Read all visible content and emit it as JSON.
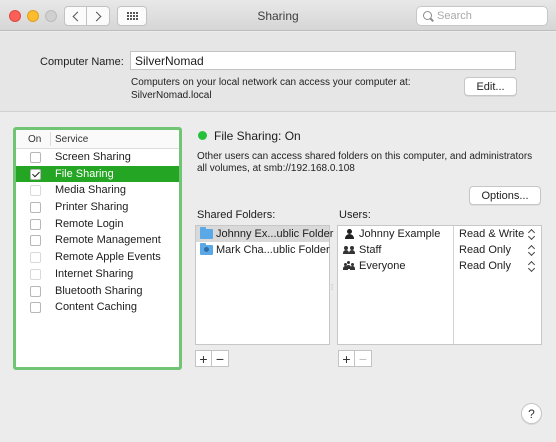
{
  "window": {
    "title": "Sharing",
    "search_placeholder": "Search"
  },
  "computer_name": {
    "label": "Computer Name:",
    "value": "SilverNomad",
    "description_line1": "Computers on your local network can access your computer at:",
    "description_line2": "SilverNomad.local",
    "edit_button": "Edit..."
  },
  "services": {
    "header_on": "On",
    "header_service": "Service",
    "items": [
      {
        "label": "Screen Sharing",
        "checked": false,
        "selected": false
      },
      {
        "label": "File Sharing",
        "checked": true,
        "selected": true
      },
      {
        "label": "Media Sharing",
        "checked": false,
        "selected": false
      },
      {
        "label": "Printer Sharing",
        "checked": false,
        "selected": false
      },
      {
        "label": "Remote Login",
        "checked": false,
        "selected": false
      },
      {
        "label": "Remote Management",
        "checked": false,
        "selected": false
      },
      {
        "label": "Remote Apple Events",
        "checked": false,
        "selected": false
      },
      {
        "label": "Internet Sharing",
        "checked": false,
        "selected": false
      },
      {
        "label": "Bluetooth Sharing",
        "checked": false,
        "selected": false
      },
      {
        "label": "Content Caching",
        "checked": false,
        "selected": false
      }
    ]
  },
  "status": {
    "text": "File Sharing: On",
    "color": "#26c03a",
    "description": "Other users can access shared folders on this computer, and administrators all volumes, at smb://192.168.0.108",
    "options_button": "Options..."
  },
  "shared_folders": {
    "label": "Shared Folders:",
    "items": [
      {
        "label": "Johnny Ex...ublic Folder",
        "icon": "folder-icon"
      },
      {
        "label": "Mark Cha...ublic Folder",
        "icon": "shared-folder-icon"
      }
    ],
    "add": "+",
    "remove": "−"
  },
  "users": {
    "label": "Users:",
    "items": [
      {
        "name": "Johnny Example",
        "permission": "Read & Write",
        "icon": "user-icon"
      },
      {
        "name": "Staff",
        "permission": "Read Only",
        "icon": "group-icon"
      },
      {
        "name": "Everyone",
        "permission": "Read Only",
        "icon": "everyone-icon"
      }
    ],
    "add": "+",
    "remove": "−"
  },
  "help": "?",
  "colors": {
    "accent_selection": "#25a524",
    "highlight_border": "#72c475"
  }
}
